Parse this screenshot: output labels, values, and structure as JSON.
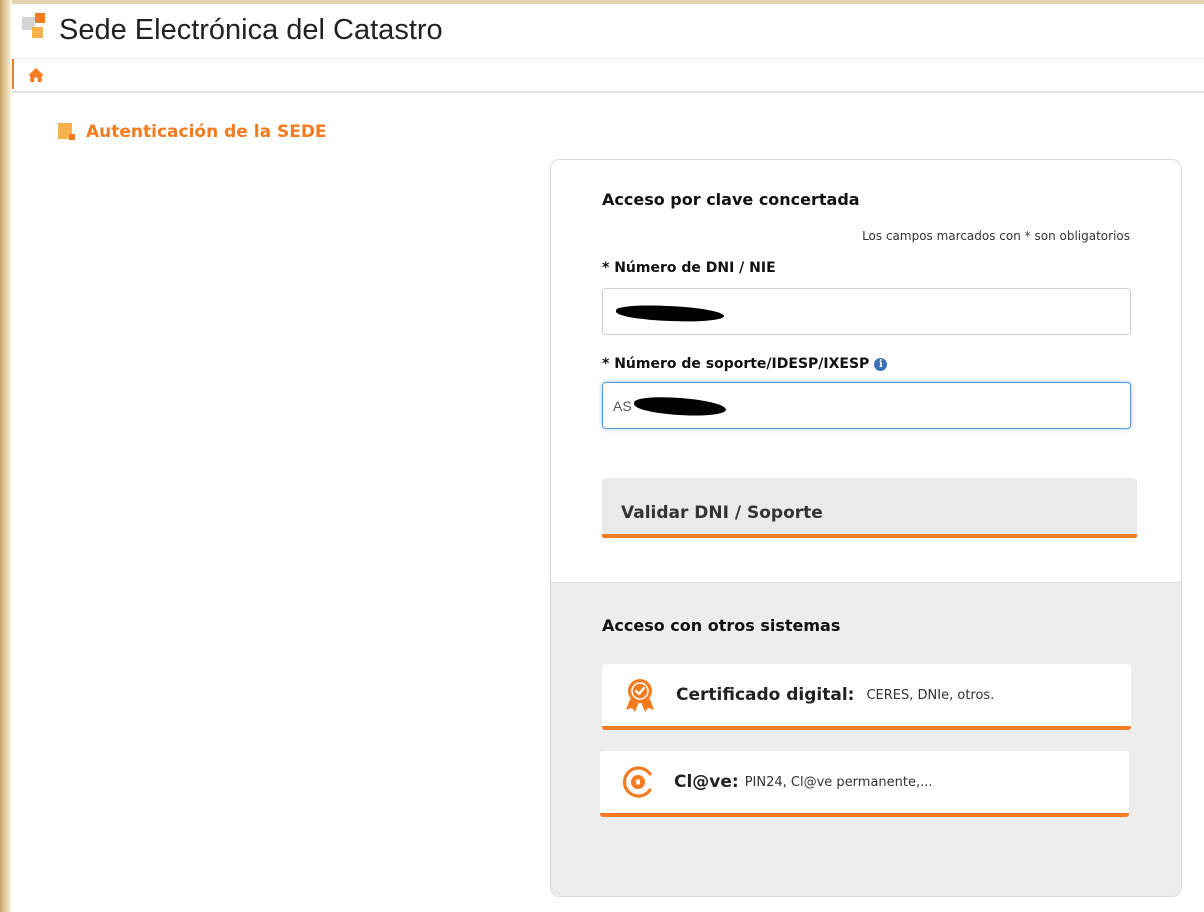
{
  "header": {
    "title": "Sede Electrónica del Catastro"
  },
  "nav": {
    "home_icon": "home-icon"
  },
  "section": {
    "title": "Autenticación de la SEDE"
  },
  "clave_concertada": {
    "heading": "Acceso por clave concertada",
    "required_note": "Los campos marcados con * son obligatorios",
    "dni_label": "* Número de DNI / NIE",
    "dni_value": "",
    "soporte_label": "* Número de soporte/IDESP/IXESP",
    "soporte_value_prefix": "AS",
    "validate_label": "Validar DNI / Soporte"
  },
  "otros_sistemas": {
    "heading": "Acceso con otros sistemas",
    "certificado": {
      "title": "Certificado digital:",
      "description": "CERES, DNIe, otros."
    },
    "clave": {
      "title": "Cl@ve:",
      "description": "PIN24, Cl@ve permanente,..."
    }
  },
  "colors": {
    "accent": "#f47b20",
    "accent_light": "#f7b24a",
    "info": "#3b6fb6",
    "panel_gray": "#ededed"
  }
}
